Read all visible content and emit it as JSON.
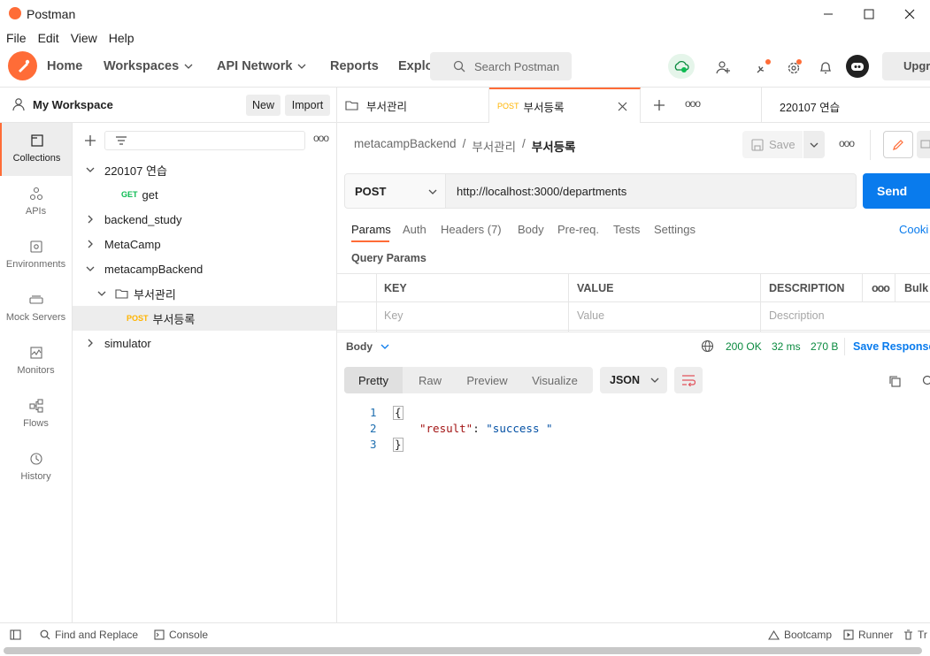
{
  "window": {
    "title": "Postman"
  },
  "menu": [
    "File",
    "Edit",
    "View",
    "Help"
  ],
  "header": {
    "nav": [
      "Home",
      "Workspaces",
      "API Network",
      "Reports",
      "Explo"
    ],
    "search_placeholder": "Search Postman",
    "upgrade_label": "Upgr"
  },
  "workspace": {
    "name": "My Workspace",
    "new_label": "New",
    "import_label": "Import"
  },
  "rail": [
    {
      "label": "Collections",
      "icon": "collections-icon"
    },
    {
      "label": "APIs",
      "icon": "apis-icon"
    },
    {
      "label": "Environments",
      "icon": "environments-icon"
    },
    {
      "label": "Mock Servers",
      "icon": "mock-servers-icon"
    },
    {
      "label": "Monitors",
      "icon": "monitors-icon"
    },
    {
      "label": "Flows",
      "icon": "flows-icon"
    },
    {
      "label": "History",
      "icon": "history-icon"
    }
  ],
  "tree": [
    {
      "label": "220107 연습"
    },
    {
      "label": "get",
      "method": "GET"
    },
    {
      "label": "backend_study"
    },
    {
      "label": "MetaCamp"
    },
    {
      "label": "metacampBackend"
    },
    {
      "label": "부서관리"
    },
    {
      "label": "부서등록",
      "method": "POST"
    },
    {
      "label": "simulator"
    }
  ],
  "tabs": [
    {
      "label": "부서관리"
    },
    {
      "label": "부서등록",
      "method": "POST"
    },
    {
      "label": "220107 연습"
    }
  ],
  "breadcrumb": {
    "root": "metacampBackend",
    "sep": "/",
    "folder": "부서관리",
    "current": "부서등록"
  },
  "save_label": "Save",
  "request": {
    "method": "POST",
    "url": "http://localhost:3000/departments",
    "send_label": "Send"
  },
  "request_tabs": [
    "Params",
    "Auth",
    "Headers (7)",
    "Body",
    "Pre-req.",
    "Tests",
    "Settings"
  ],
  "cookies_label": "Cooki",
  "params": {
    "title": "Query Params",
    "headers": [
      "KEY",
      "VALUE",
      "DESCRIPTION",
      "Bulk"
    ],
    "placeholders": [
      "Key",
      "Value",
      "Description"
    ]
  },
  "response": {
    "body_label": "Body",
    "status": "200 OK",
    "time": "32 ms",
    "size": "270 B",
    "save_label": "Save Response",
    "views": [
      "Pretty",
      "Raw",
      "Preview",
      "Visualize"
    ],
    "format": "JSON",
    "lines": [
      "1",
      "2",
      "3"
    ],
    "code": {
      "open": "{",
      "key": "\"result\"",
      "colon": ":",
      "value": "\"success \"",
      "close": "}"
    }
  },
  "footer": {
    "find_replace": "Find and Replace",
    "console": "Console",
    "bootcamp": "Bootcamp",
    "runner": "Runner",
    "trash": "Tr"
  },
  "colors": {
    "accent": "#ff6c37",
    "primary": "#097bed",
    "success": "#0a8a3f"
  }
}
